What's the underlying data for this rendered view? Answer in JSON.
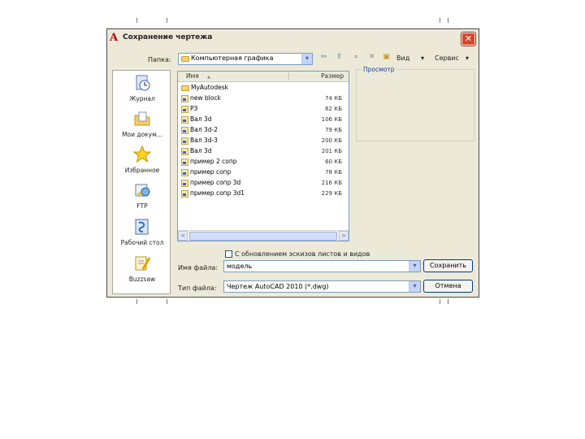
{
  "dialog": {
    "title": "Сохранение чертежа",
    "close_symbol": "✕",
    "app_icon_symbol": "A"
  },
  "toolbar": {
    "folder_label": "Папка:",
    "folder_value": "Компьютерная графика",
    "views_label": "Вид",
    "tools_label": "Сервис",
    "dropdown_symbol": "▾",
    "back_symbol": "⇦",
    "up_symbol": "⇧",
    "search_symbol": "⌕",
    "delete_symbol": "✕",
    "newfolder_symbol": "▣"
  },
  "places": [
    {
      "label": "Журнал",
      "icon": "history-icon"
    },
    {
      "label": "Мои докум...",
      "icon": "my-documents-icon"
    },
    {
      "label": "Избранное",
      "icon": "favorites-star-icon"
    },
    {
      "label": "FTP",
      "icon": "ftp-icon"
    },
    {
      "label": "Рабочий стол",
      "icon": "desktop-icon"
    },
    {
      "label": "Buzzsaw",
      "icon": "buzzsaw-icon"
    }
  ],
  "filelist": {
    "col_name": "Имя",
    "col_size": "Размер",
    "sort_symbol": "▲",
    "rows": [
      {
        "name": "MyAutodesk",
        "size": "",
        "type": "folder"
      },
      {
        "name": "new block",
        "size": "74 КБ",
        "type": "dwg"
      },
      {
        "name": "P3",
        "size": "62 КБ",
        "type": "dwg"
      },
      {
        "name": "Вал 3d",
        "size": "106 КБ",
        "type": "dwg"
      },
      {
        "name": "Вал 3d-2",
        "size": "79 КБ",
        "type": "dwg"
      },
      {
        "name": "Вал 3d-3",
        "size": "200 КБ",
        "type": "dwg"
      },
      {
        "name": "Вал 3d",
        "size": "201 КБ",
        "type": "dwg"
      },
      {
        "name": "пример 2 сопр",
        "size": "60 КБ",
        "type": "dwg"
      },
      {
        "name": "пример сопр",
        "size": "78 КБ",
        "type": "dwg"
      },
      {
        "name": "пример сопр 3d",
        "size": "216 КБ",
        "type": "dwg"
      },
      {
        "name": "пример сопр 3d1",
        "size": "229 КБ",
        "type": "dwg"
      }
    ],
    "scroll_left": "<",
    "scroll_right": ">"
  },
  "preview": {
    "label": "Просмотр"
  },
  "options": {
    "checkbox_label": "С обновлением эскизов листов и видов",
    "checked": false
  },
  "filename": {
    "label": "Имя файла:",
    "value": "модель"
  },
  "filetype": {
    "label": "Тип файла:",
    "value": "Чертеж AutoCAD 2010 (*.dwg)"
  },
  "buttons": {
    "save": "Сохранить",
    "cancel": "Отмена"
  }
}
